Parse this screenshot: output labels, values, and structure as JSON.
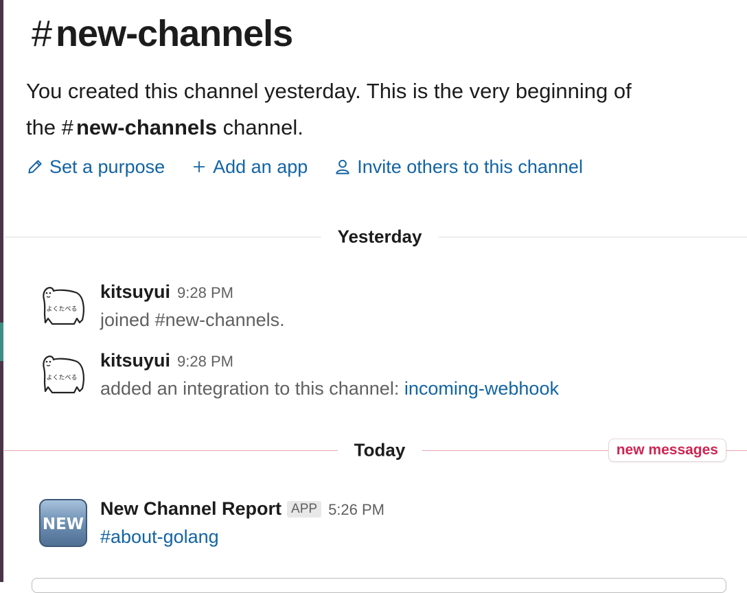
{
  "channel": {
    "hash": "#",
    "name": "new-channels"
  },
  "intro": {
    "line1": "You created this channel yesterday. This is the very beginning of",
    "line2_prefix": "the",
    "hash": "#",
    "channel_name": "new-channels",
    "line2_suffix": "channel."
  },
  "actions": {
    "set_purpose": "Set a purpose",
    "add_app": "Add an app",
    "invite": "Invite others to this channel"
  },
  "dividers": {
    "yesterday": "Yesterday",
    "today": "Today",
    "new_messages": "new messages"
  },
  "messages": [
    {
      "author": "kitsuyui",
      "time": "9:28 PM",
      "text": "joined #new-channels.",
      "avatar_label": "よくたべる"
    },
    {
      "author": "kitsuyui",
      "time": "9:28 PM",
      "text": "added an integration to this channel:",
      "link": "incoming-webhook",
      "avatar_label": "よくたべる"
    },
    {
      "author": "New Channel Report",
      "app_tag": "APP",
      "time": "5:26 PM",
      "link": "#about-golang",
      "avatar_label": "NEW"
    }
  ],
  "colors": {
    "link": "#1264a3",
    "new_messages": "#cd2553",
    "sidebar": "#4a3548"
  },
  "icons": [
    "pencil-icon",
    "plus-icon",
    "person-icon"
  ]
}
